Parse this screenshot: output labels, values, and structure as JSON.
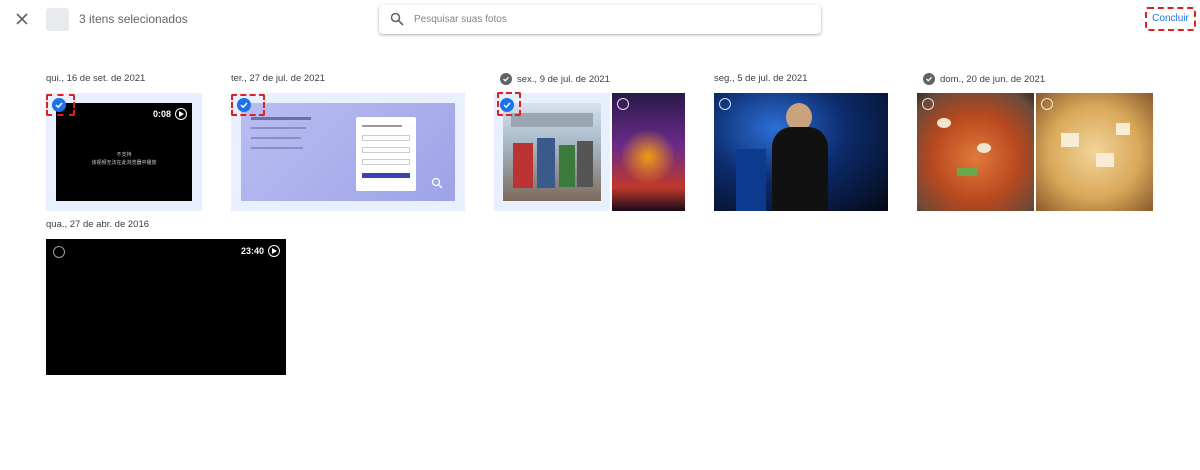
{
  "header": {
    "selection_text": "3 itens selecionados",
    "search_placeholder": "Pesquisar suas fotos",
    "done_label": "Concluir"
  },
  "groups": [
    {
      "date": "qui., 16 de set. de 2021",
      "video_duration": "0:08",
      "video_caption": "不支持\n该视频无法在此浏览器中播放"
    },
    {
      "date": "ter., 27 de jul. de 2021"
    },
    {
      "date": "sex., 9 de jul. de 2021"
    },
    {
      "date": "seg., 5 de jul. de 2021"
    },
    {
      "date": "dom., 20 de jun. de 2021"
    },
    {
      "date": "qua., 27 de abr. de 2016",
      "video_duration": "23:40"
    }
  ],
  "colors": {
    "accent": "#1a73e8",
    "highlight": "#e02020",
    "selected_bg": "#e8f0fe"
  },
  "icons": [
    "close-icon",
    "search-icon",
    "check-icon",
    "play-icon",
    "zoom-icon"
  ]
}
